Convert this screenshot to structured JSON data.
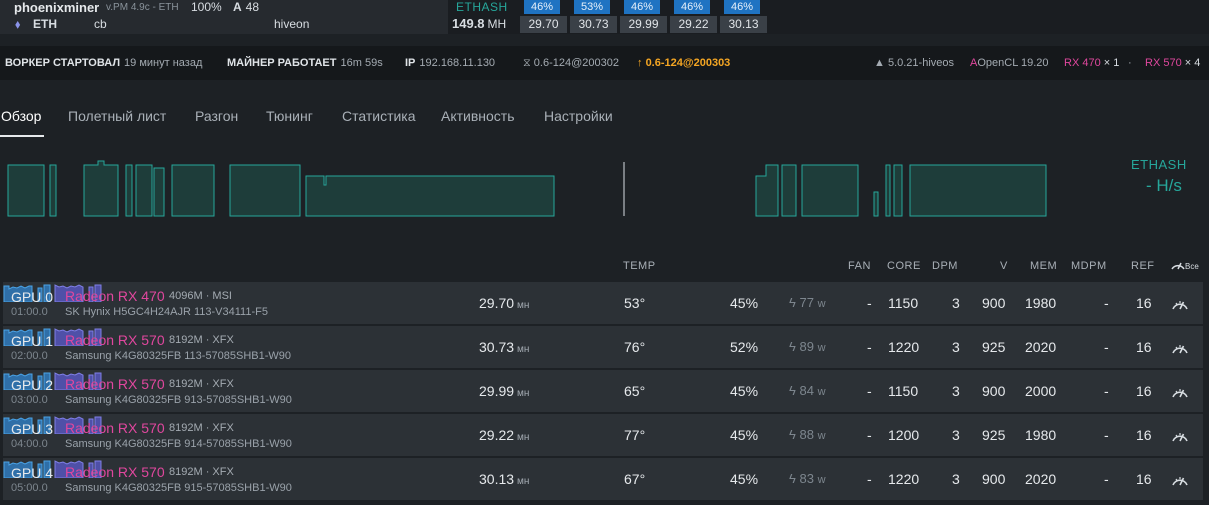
{
  "miner": {
    "name": "phoenixminer",
    "version": "v.PM 4.9c - ETH",
    "percent": "100%",
    "a_label": "A",
    "a_value": "48",
    "coin": "ETH",
    "wallet": "cb",
    "pool": "hiveon",
    "total_hashrate": "149.8",
    "total_unit": "MH",
    "algo": "ETHASH",
    "gpu_cells": [
      {
        "pct": "46%",
        "hr": "29.70"
      },
      {
        "pct": "53%",
        "hr": "30.73"
      },
      {
        "pct": "46%",
        "hr": "29.99"
      },
      {
        "pct": "46%",
        "hr": "29.22"
      },
      {
        "pct": "46%",
        "hr": "30.13"
      }
    ]
  },
  "info": {
    "worker_label": "ВОРКЕР СТАРТОВАЛ",
    "worker_value": "19 минут назад",
    "miner_label": "МАЙНЕР РАБОТАЕТ",
    "miner_value": "16m 59s",
    "ip_label": "IP",
    "ip_value": "192.168.11.130",
    "version": "0.6-124@200302",
    "update_version": "0.6-124@200303",
    "kernel": "5.0.21-hiveos",
    "opencl": "OpenCL 19.20",
    "gpu_type_1": "RX 470",
    "gpu_count_1": "× 1",
    "gpu_type_2": "RX 570",
    "gpu_count_2": "× 4"
  },
  "tabs": [
    "Обзор",
    "Полетный лист",
    "Разгон",
    "Тюнинг",
    "Статистика",
    "Активность",
    "Настройки"
  ],
  "chart": {
    "algo": "ETHASH",
    "value": "- H/s"
  },
  "table": {
    "headers": {
      "temp": "TEMP",
      "fan": "FAN",
      "core": "CORE",
      "dpm": "DPM",
      "v": "V",
      "mem": "MEM",
      "mdpm": "MDPM",
      "ref": "REF",
      "all": "Все"
    },
    "hr_unit": "мн",
    "power_unit": "w",
    "rows": [
      {
        "gpu": "GPU 0",
        "bus": "01:00.0",
        "model": "Radeon RX 470",
        "mem": "4096M · MSI",
        "vram": "SK Hynix H5GC4H24AJR 113-V34111-F5",
        "hr": "29.70",
        "temp": "53°",
        "fan": "45%",
        "power": "77",
        "fan_rpm": "-",
        "core": "1150",
        "dpm": "3",
        "v": "900",
        "memclk": "1980",
        "mdpm": "-",
        "ref": "16"
      },
      {
        "gpu": "GPU 1",
        "bus": "02:00.0",
        "model": "Radeon RX 570",
        "mem": "8192M · XFX",
        "vram": "Samsung K4G80325FB 113-57085SHB1-W90",
        "hr": "30.73",
        "temp": "76°",
        "fan": "52%",
        "power": "89",
        "fan_rpm": "-",
        "core": "1220",
        "dpm": "3",
        "v": "925",
        "memclk": "2020",
        "mdpm": "-",
        "ref": "16"
      },
      {
        "gpu": "GPU 2",
        "bus": "03:00.0",
        "model": "Radeon RX 570",
        "mem": "8192M · XFX",
        "vram": "Samsung K4G80325FB 913-57085SHB1-W90",
        "hr": "29.99",
        "temp": "65°",
        "fan": "45%",
        "power": "84",
        "fan_rpm": "-",
        "core": "1150",
        "dpm": "3",
        "v": "900",
        "memclk": "2000",
        "mdpm": "-",
        "ref": "16"
      },
      {
        "gpu": "GPU 3",
        "bus": "04:00.0",
        "model": "Radeon RX 570",
        "mem": "8192M · XFX",
        "vram": "Samsung K4G80325FB 914-57085SHB1-W90",
        "hr": "29.22",
        "temp": "77°",
        "fan": "45%",
        "power": "88",
        "fan_rpm": "-",
        "core": "1200",
        "dpm": "3",
        "v": "925",
        "memclk": "1980",
        "mdpm": "-",
        "ref": "16"
      },
      {
        "gpu": "GPU 4",
        "bus": "05:00.0",
        "model": "Radeon RX 570",
        "mem": "8192M · XFX",
        "vram": "Samsung K4G80325FB 915-57085SHB1-W90",
        "hr": "30.13",
        "temp": "67°",
        "fan": "45%",
        "power": "83",
        "fan_rpm": "-",
        "core": "1220",
        "dpm": "3",
        "v": "900",
        "memclk": "2020",
        "mdpm": "-",
        "ref": "16"
      }
    ]
  }
}
